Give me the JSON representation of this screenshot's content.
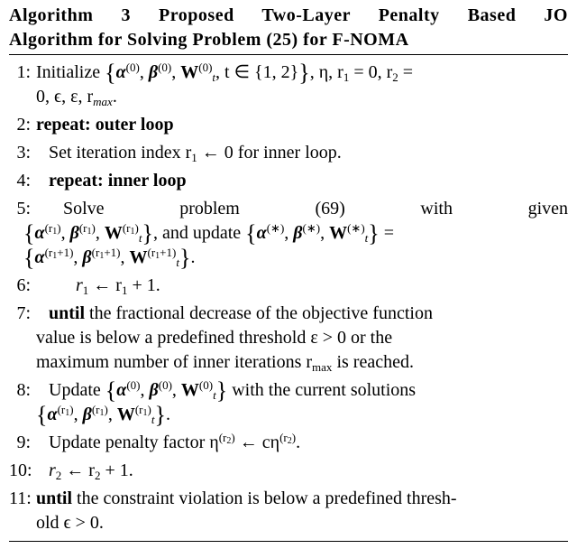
{
  "title_l1_prefix": "Algorithm 3",
  "title_l1_rest": " Proposed Two-Layer Penalty Based JO",
  "title_l2": "Algorithm for Solving Problem (25) for F-NOMA",
  "steps": {
    "n1": "1:",
    "n2": "2:",
    "n3": "3:",
    "n4": "4:",
    "n5": "5:",
    "n6": "6:",
    "n7": "7:",
    "n8": "8:",
    "n9": "9:",
    "n10": "10:",
    "n11": "11:"
  },
  "s1_pre": "Initialize ",
  "s1_brL": "{",
  "s1_alpha": "α",
  "s1_sup0": "(0)",
  "s1_c1": ", ",
  "s1_beta": "β",
  "s1_c2": ", ",
  "s1_W": "W",
  "s1_Wsub": "t",
  "s1_c3": ", t ∈ {1, 2}",
  "s1_brR": "}",
  "s1_mid": ", η, r",
  "s1_r1sub": "1",
  "s1_eq0a": " = 0, r",
  "s1_r2sub": "2",
  "s1_eq0b": " =",
  "s1_line2": "0, ϵ, ε, r",
  "s1_rmax": "max",
  "s1_dot": ".",
  "s2": "repeat: outer loop",
  "s3_a": "Set iteration index r",
  "s3_sub": "1",
  "s3_b": " ← 0 for inner loop.",
  "s4": "repeat: inner loop",
  "s5_l1_a": "Solve",
  "s5_l1_b": "problem",
  "s5_l1_c": "(69)",
  "s5_l1_d": "with",
  "s5_l1_e": "given",
  "s5_supr1": "(r",
  "s5_supr1b": ")",
  "s5_mid": ", and update ",
  "s5_star": "(∗)",
  "s5_eq": " =",
  "s5_supr1p": "(r",
  "s5_plus1": "+1)",
  "s6_a": "r",
  "s6_sub": "1",
  "s6_b": " ← r",
  "s6_c": " + 1.",
  "s7_until": "until",
  "s7_a": " the fractional decrease of the objective function",
  "s7_b": "value is below a predefined threshold ε > 0 or the",
  "s7_c": "maximum number of inner iterations r",
  "s7_max": "max",
  "s7_d": " is reached.",
  "s8_a": "Update ",
  "s8_b": " with the current solutions",
  "s8_dot": ".",
  "s9_a": "Update penalty factor η",
  "s9_supr2": "(r",
  "s9_sub2": "2",
  "s9_supclose": ")",
  "s9_b": " ← cη",
  "s10_a": "r",
  "s10_sub": "2",
  "s10_b": " ← r",
  "s10_c": " + 1.",
  "s11_until": "until",
  "s11_a": " the constraint violation is below a predefined thresh-",
  "s11_b": "old ϵ > 0."
}
